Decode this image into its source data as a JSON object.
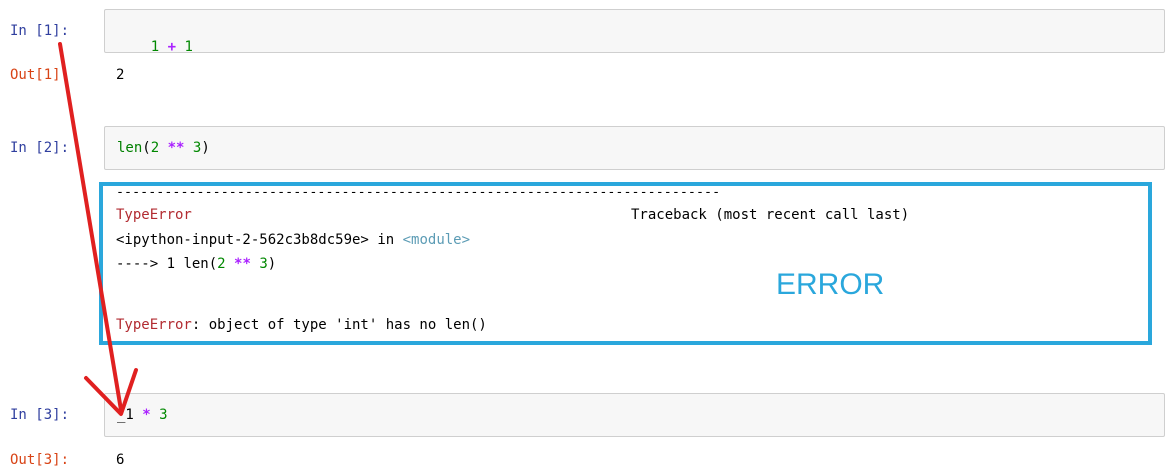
{
  "cells": [
    {
      "in_prompt": "In [1]:",
      "code": {
        "a": "1",
        "op": "+",
        "b": "1"
      },
      "out_prompt": "Out[1]:",
      "output": "2"
    },
    {
      "in_prompt": "In [2]:",
      "code": {
        "fn": "len",
        "open": "(",
        "a": "2",
        "op": "**",
        "b": "3",
        "close": ")"
      },
      "traceback": {
        "separator": "---------------------------------------------------------------------------",
        "error_type": "TypeError",
        "traceback_header": "Traceback (most recent call last)",
        "input_ref": "<ipython-input-2-562c3b8dc59e>",
        "in_word": "in",
        "module": "<module>",
        "arrow_line_prefix": "----> 1 ",
        "arrow_fn": "len",
        "arrow_open": "(",
        "arrow_a": "2",
        "arrow_op": "**",
        "arrow_b": "3",
        "arrow_close": ")",
        "error_message_type": "TypeError",
        "error_message": ": object of type 'int' has no len()"
      },
      "annotation_label": "ERROR"
    },
    {
      "in_prompt": "In [3]:",
      "code": {
        "a": "_1",
        "op": "*",
        "b": "3"
      },
      "out_prompt": "Out[3]:",
      "output": "6"
    }
  ],
  "colors": {
    "in_prompt": "#303f9f",
    "out_prompt": "#d84315",
    "annotation_box": "#2aa7dc",
    "annotation_arrow": "#e02020"
  }
}
